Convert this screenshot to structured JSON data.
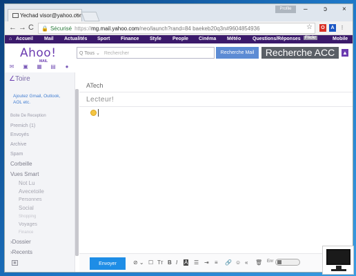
{
  "browser": {
    "tab_title": "Yechad visor@yahoo.com",
    "tab_close": "×",
    "profile_chip": "Profile",
    "window_controls": {
      "minimize": "–",
      "restore": "ɔ",
      "close": "×"
    },
    "nav": {
      "back": "←",
      "forward": "→",
      "reload": "C"
    },
    "address": {
      "secure_label": "Sécurisé",
      "url_prefix": "https://",
      "url_domain": "mg.mail.yahoo.com",
      "url_rest": "/neo/launch?rand=84 baekeb20q3n#9604854936"
    },
    "star": "☆",
    "extensions": [
      {
        "label": "O",
        "color": "#d93025"
      },
      {
        "label": "A",
        "color": "#1a56c4"
      },
      {
        "label": "⋮",
        "color": "#777777"
      }
    ]
  },
  "yahoo_nav": {
    "items": [
      "Accueil",
      "Mail",
      "Actualités",
      "Sport",
      "Finance",
      "Style",
      "People",
      "Cinéma",
      "Météo",
      "Questions/Réponses",
      "Flickr",
      "Mobile"
    ]
  },
  "header": {
    "logo": "Ahoo!",
    "logo_sub": "MAIL",
    "app_icons": [
      "mail-icon",
      "contacts-icon",
      "calendar-icon",
      "notepad-icon",
      "messenger-icon"
    ],
    "search": {
      "scope": "Q Tous",
      "scope_caret": "⌄",
      "placeholder": "Rechercher"
    },
    "btn_search_mail": "Recherche Mail",
    "btn_search_web": "Recherche ACC",
    "user_icon": "👤"
  },
  "sidebar": {
    "compose": "Toire",
    "add_gmail": "Ajoutez Gmail, Outlook, AOL etc.",
    "folders": [
      "Boite De Reception",
      "Premich (1)",
      "Envoyés",
      "Archive",
      "Spam",
      "Corbeille",
      "Vues Smart"
    ],
    "smart_views": [
      "Not Lu",
      "Avecetoile",
      "Personnes",
      "Social",
      "Shopping",
      "Voyages",
      "Finance"
    ],
    "sections": [
      "Dossier",
      "Recents"
    ]
  },
  "compose": {
    "to": "ATech",
    "subject": "Lecteur!",
    "send_label": "Envoyer",
    "toolbar": {
      "attach": "⊘ ⌄",
      "insert": "☐",
      "font_size": "Tт",
      "bold": "B",
      "italic": "I",
      "text_color": "A",
      "bullets": "☰",
      "indent": "⇥",
      "align": "≡",
      "link": "🔗",
      "emoji": "☺",
      "more": "«",
      "delete": "🗑",
      "enr": "Enr"
    }
  }
}
